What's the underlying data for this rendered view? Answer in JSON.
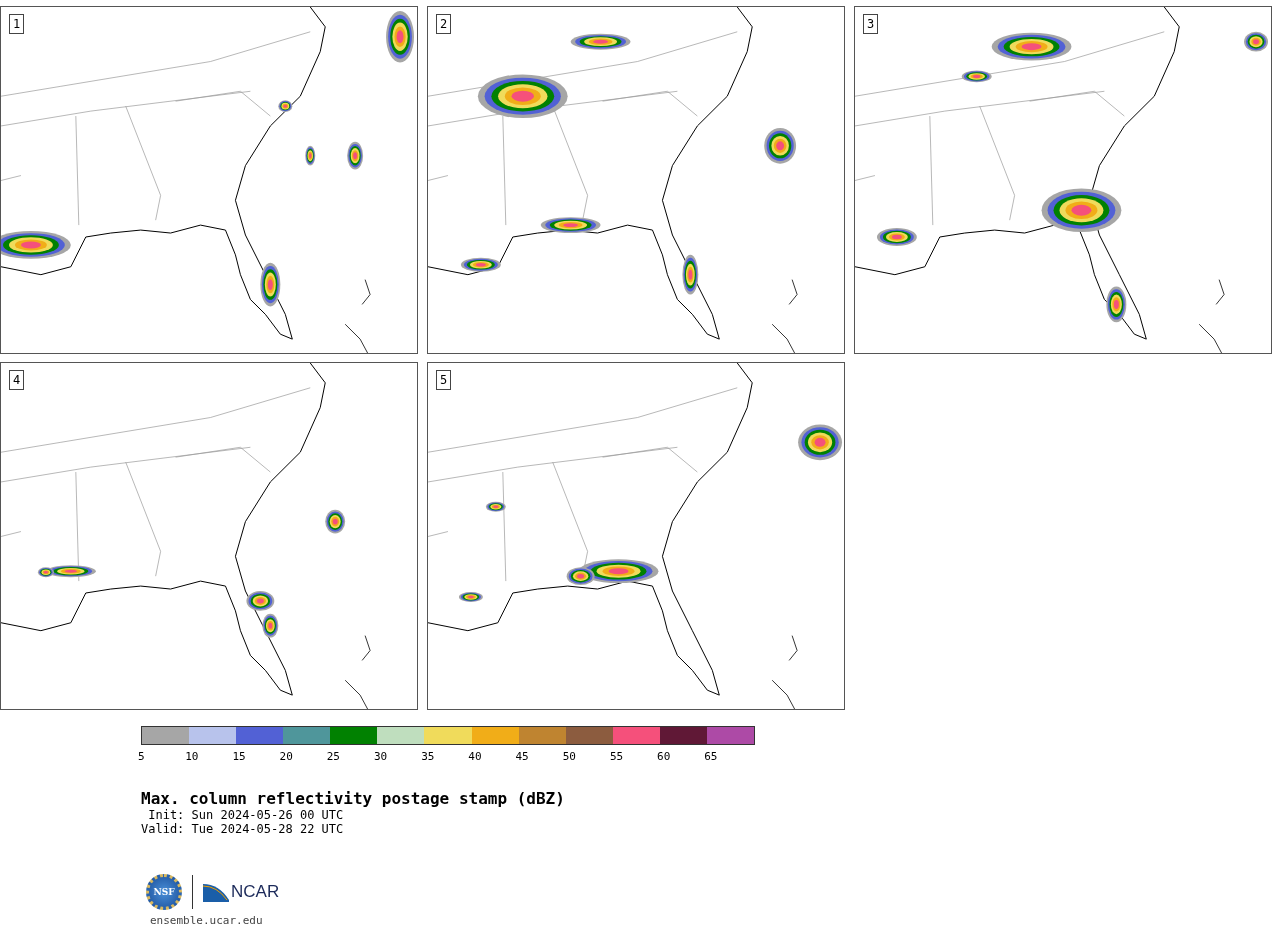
{
  "panels": [
    {
      "label": "1"
    },
    {
      "label": "2"
    },
    {
      "label": "3"
    },
    {
      "label": "4"
    },
    {
      "label": "5"
    }
  ],
  "colorbar": {
    "segments": [
      {
        "color": "#a6a6a6"
      },
      {
        "color": "#b8c3ec"
      },
      {
        "color": "#5261d5"
      },
      {
        "color": "#4f969b"
      },
      {
        "color": "#018101"
      },
      {
        "color": "#bfdebe"
      },
      {
        "color": "#f0db5b"
      },
      {
        "color": "#f1ad18"
      },
      {
        "color": "#bf8430"
      },
      {
        "color": "#8c5c3f"
      },
      {
        "color": "#f5507b"
      },
      {
        "color": "#601836"
      },
      {
        "color": "#ad4aa6"
      }
    ],
    "ticks": [
      "5",
      "10",
      "15",
      "20",
      "25",
      "30",
      "35",
      "40",
      "45",
      "50",
      "55",
      "60",
      "65"
    ]
  },
  "title": "Max. column reflectivity postage stamp (dBZ)",
  "init": " Init: Sun 2024-05-26 00 UTC",
  "valid": "Valid: Tue 2024-05-28 22 UTC",
  "logo": {
    "seal": "NSF",
    "name": "NCAR"
  },
  "site": "ensemble.ucar.edu"
}
